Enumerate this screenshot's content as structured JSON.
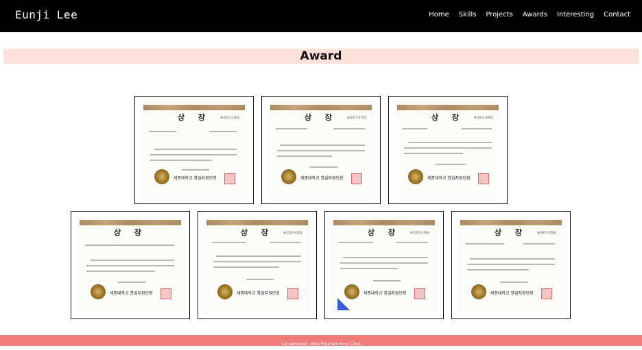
{
  "header": {
    "brand": "Eunji Lee",
    "nav": [
      "Home",
      "Skills",
      "Projects",
      "Awards",
      "Interesting",
      "Contact"
    ]
  },
  "section": {
    "title": "Award"
  },
  "certificates": [
    {
      "title": "상 장",
      "number": "제 2021-132호",
      "issuer": "세종대학교 창업지원단장"
    },
    {
      "title": "상 장",
      "number": "제 2021-375호",
      "issuer": "세종대학교 창업지원단장"
    },
    {
      "title": "상 장",
      "number": "제 2021-439호",
      "issuer": "세종대학교 창업지원단장"
    },
    {
      "title": "상 장",
      "number": "",
      "issuer": "세종대학교 창업지원단장"
    },
    {
      "title": "상 장",
      "number": "제 2021-411호",
      "issuer": "세종대학교 창업지원단장"
    },
    {
      "title": "상 장",
      "number": "제 2021-374호",
      "issuer": "세종대학교 창업지원단장"
    },
    {
      "title": "상 장",
      "number": "제 2021-560호",
      "issuer": "세종대학교 창업지원단장"
    }
  ],
  "footer": {
    "text": "1st semester, Web Programming Class"
  },
  "colors": {
    "topbar": "#000000",
    "award_bar": "#fde0da",
    "footer": "#ef7b7b"
  }
}
